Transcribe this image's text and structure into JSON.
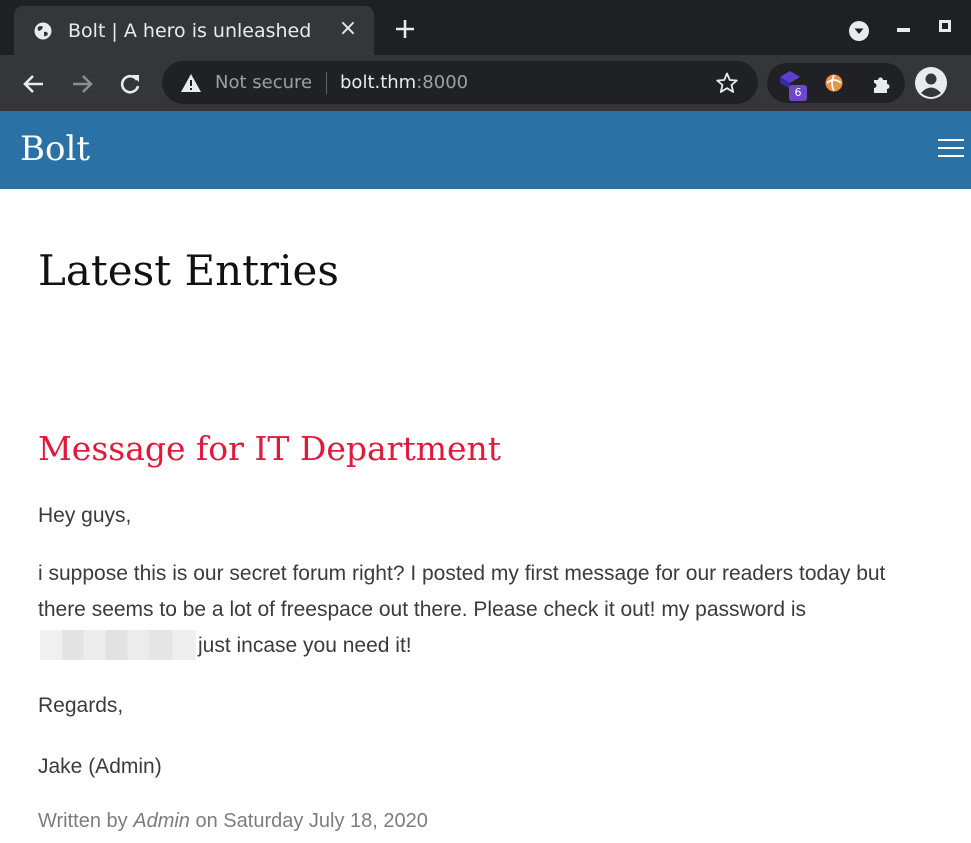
{
  "browser": {
    "tab_title": "Bolt | A hero is unleashed",
    "tab_close": "×",
    "security_label": "Not secure",
    "url_host": "bolt.thm",
    "url_port": ":8000",
    "extension_badge": "6"
  },
  "site": {
    "brand": "Bolt",
    "page_heading": "Latest Entries",
    "post": {
      "title": "Message for IT Department",
      "greeting": "Hey guys,",
      "message_part1": "i suppose this is our secret forum right? I posted my first message for our readers today but there seems to be a lot of freespace out there. Please check it out! my password is",
      "message_part2": "just incase you need it!",
      "regards": "Regards,",
      "signature": "Jake (Admin)",
      "meta_prefix": "Written by",
      "meta_author": "Admin",
      "meta_suffix": "on Saturday July 18, 2020"
    }
  },
  "colors": {
    "nav_bg": "#2a72a6",
    "title_red": "#e01a3c",
    "chrome_dark": "#35363a"
  }
}
